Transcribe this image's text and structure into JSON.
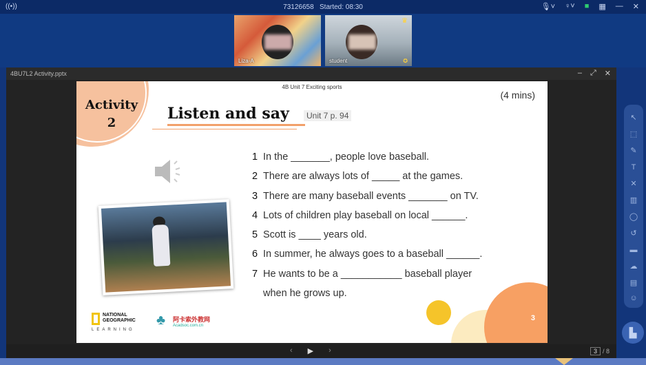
{
  "topbar": {
    "left_icon": "broadcast-icon",
    "meeting_id": "73126658",
    "started": "Started: 08:30",
    "right_icons": [
      "microphone-icon",
      "person-icon",
      "green-status-icon",
      "grid-icon",
      "minimize-icon",
      "close-icon"
    ]
  },
  "video": {
    "tiles": [
      {
        "name": "Liza-A"
      },
      {
        "name": "student"
      }
    ]
  },
  "ppt": {
    "filename": "4BU7L2 Activity.pptx",
    "controls": [
      "minimize-icon",
      "fullscreen-icon",
      "close-icon"
    ]
  },
  "slide": {
    "top_caption": "4B Unit 7 Exciting sports",
    "activity_line1": "Activity",
    "activity_line2": "2",
    "time": "(4 mins)",
    "title": "Listen and say",
    "unit_ref": "Unit 7 p. 94",
    "questions": [
      {
        "num": "1",
        "text": "In the _______, people love baseball."
      },
      {
        "num": "2",
        "text": "There are always lots of _____ at the games."
      },
      {
        "num": "3",
        "text": "There are many baseball events _______ on TV."
      },
      {
        "num": "4",
        "text": "Lots of children play baseball on local ______."
      },
      {
        "num": "5",
        "text": "Scott is ____ years old."
      },
      {
        "num": "6",
        "text": "In summer, he always goes to a baseball ______."
      },
      {
        "num": "7",
        "text": "He wants to be a ___________ baseball player"
      },
      {
        "num": "",
        "text": "when he grows up."
      }
    ],
    "ng_logo_text_1": "NATIONAL",
    "ng_logo_text_2": "GEOGRAPHIC",
    "ng_learning": "LEARNING",
    "akasuo_cn": "阿卡索外教网",
    "akasuo_url": "Acadsoc.com.cn",
    "slide_number": "3"
  },
  "pager": {
    "current": "3",
    "total": "/ 8"
  },
  "colors": {
    "accent_orange": "#f7a063",
    "accent_peach": "#f6c19e",
    "yellow_dot": "#f5c42a",
    "frame_blue": "#12357a"
  }
}
